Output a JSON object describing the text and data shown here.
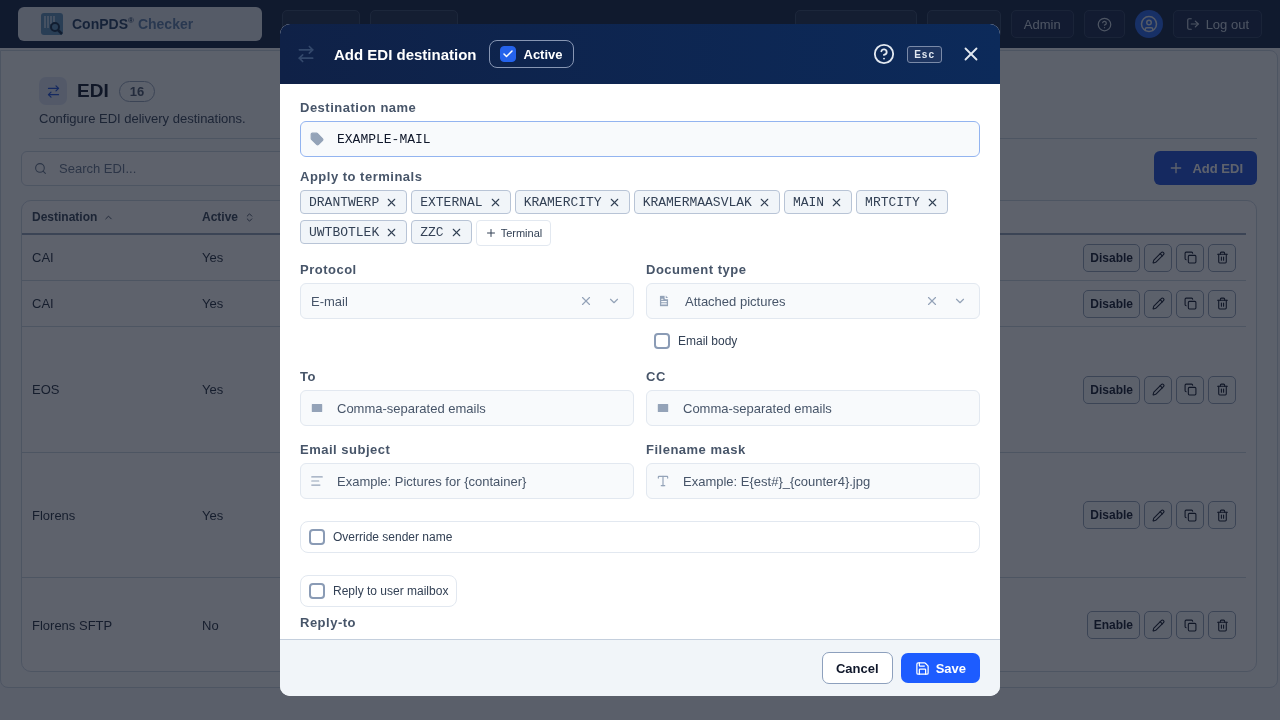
{
  "app_header": {
    "brand": "ConPDS$^{®}$",
    "brand_suffix": "Checker",
    "nav": [
      {
        "kind": "plain"
      },
      {
        "kind": "plain"
      }
    ],
    "actions": [
      {
        "kind": "plain"
      },
      {
        "kind": "plain"
      },
      {
        "kind": "text",
        "label": "Admin"
      },
      {
        "kind": "help"
      },
      {
        "kind": "avatar"
      },
      {
        "kind": "logout",
        "label": "Log out"
      }
    ]
  },
  "page": {
    "title": "EDI",
    "count": "16",
    "description": "Configure EDI delivery destinations.",
    "search": {
      "placeholder": "Search EDI..."
    },
    "add_button": "Add EDI",
    "table": {
      "columns": [
        {
          "label": "Destination",
          "sorted": true
        },
        {
          "label": "Active",
          "sorted": false
        }
      ],
      "rows": [
        {
          "destination": "CAI",
          "active": "Yes",
          "toggle": "Disable"
        },
        {
          "destination": "CAI",
          "active": "Yes",
          "toggle": "Disable"
        },
        {
          "destination": "EOS",
          "active": "Yes",
          "toggle": "Disable"
        },
        {
          "destination": "Florens",
          "active": "Yes",
          "toggle": "Disable"
        },
        {
          "destination": "Florens SFTP",
          "active": "No",
          "toggle": "Enable"
        }
      ]
    }
  },
  "modal": {
    "title": "Add EDI destination",
    "active": {
      "label": "Active",
      "checked": true
    },
    "esc": "Esc",
    "destination_name": {
      "label": "Destination name",
      "value": "EXAMPLE-MAIL",
      "focused": true
    },
    "terminals": {
      "label": "Apply to terminals",
      "add": "Terminal",
      "items": [
        "DRANTWERP",
        "EXTERNAL",
        "KRAMERCITY",
        "KRAMERMAASVLAK",
        "MAIN",
        "MRTCITY",
        "UWTBOTLEK",
        "ZZC"
      ]
    },
    "protocol": {
      "label": "Protocol",
      "value": "E-mail"
    },
    "document_type": {
      "label": "Document type",
      "value": "Attached pictures"
    },
    "email_body": {
      "label": "Email body",
      "checked": false
    },
    "to": {
      "label": "To",
      "placeholder": "Comma-separated emails"
    },
    "cc": {
      "label": "CC",
      "placeholder": "Comma-separated emails"
    },
    "email_subject": {
      "label": "Email subject",
      "placeholder": "Example: Pictures for {container}"
    },
    "filename_mask": {
      "label": "Filename mask",
      "placeholder": "Example: E{est#}_{counter4}.jpg"
    },
    "override_sender_name": {
      "label": "Override sender name",
      "checked": false
    },
    "reply_to_user_mailbox": {
      "label": "Reply to user mailbox",
      "checked": false
    },
    "reply_to": {
      "label": "Reply-to"
    },
    "cancel": "Cancel",
    "save": "Save"
  }
}
